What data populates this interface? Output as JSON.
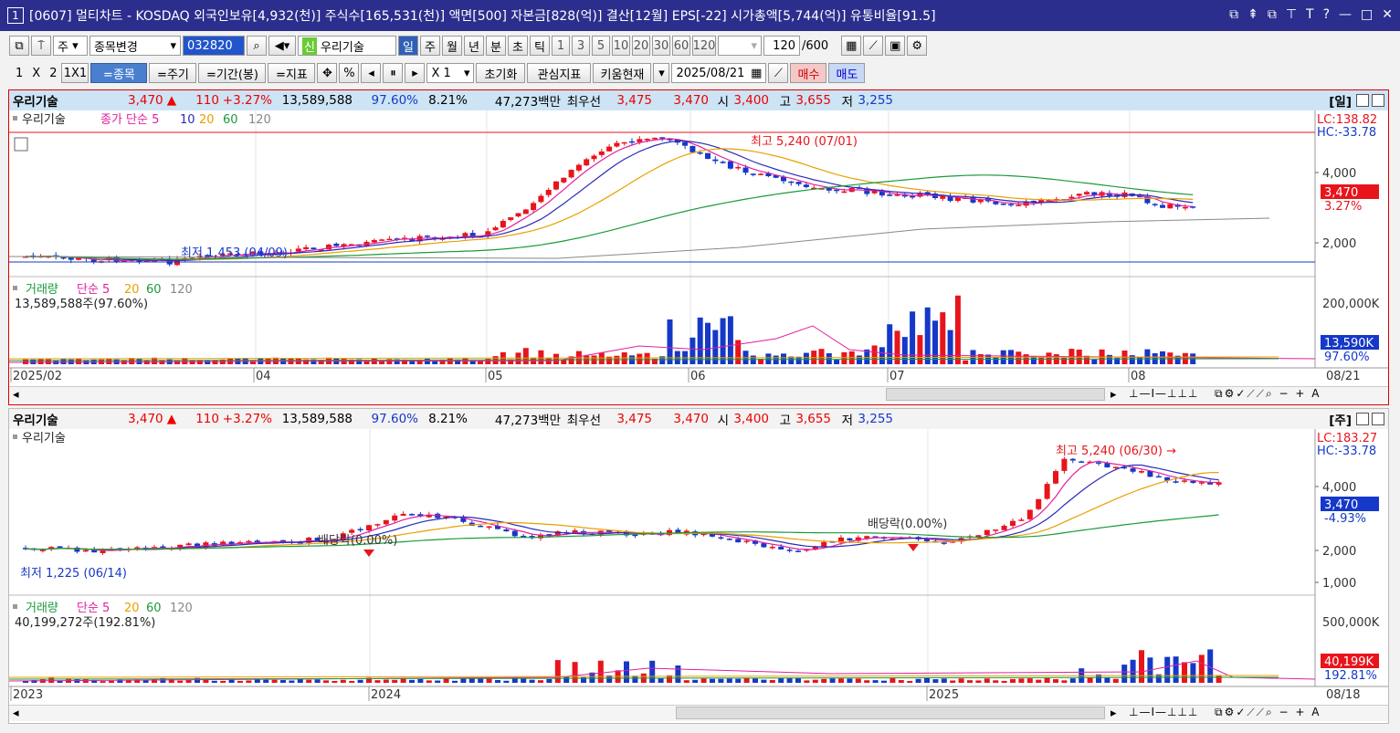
{
  "window": {
    "num": "1",
    "title": "[0607] 멀티차트 - KOSDAQ 외국인보유[4,932(천)] 주식수[165,531(천)] 액면[500] 자본금[828(억)] 결산[12월] EPS[-22] 시가총액[5,744(억)] 유통비율[91.5]",
    "controls": [
      "⧉",
      "⇞",
      "⧉",
      "⊤",
      "T",
      "?",
      "—",
      "□",
      "✕"
    ]
  },
  "toolbar1": {
    "mode": "주",
    "stock_change": "종목변경",
    "code": "032820",
    "name_badge": "신",
    "stock_name": "우리기술",
    "periods": [
      "일",
      "주",
      "월",
      "년",
      "분",
      "초",
      "틱"
    ],
    "selected_period": "일",
    "nums": [
      "1",
      "3",
      "5",
      "10",
      "20",
      "30",
      "60",
      "120"
    ],
    "count": "120",
    "total": "/600"
  },
  "toolbar2": {
    "layout": [
      "1",
      "X",
      "2"
    ],
    "layout2": "1X1",
    "btn_stock": "=종목",
    "btn_cycle": "=주기",
    "btn_range": "=기간(봉)",
    "btn_indicator": "=지표",
    "pct": "%",
    "zoom": "X 1",
    "reset": "초기화",
    "interest": "관심지표",
    "kiwoom": "키움현재",
    "date": "2025/08/21",
    "buy": "매수",
    "sell": "매도"
  },
  "colors": {
    "up": "#e8141c",
    "down": "#1538c8",
    "ma5": "#e020a0",
    "ma10": "#2a2ab8",
    "ma20": "#e8a000",
    "ma60": "#1a9a3a",
    "ma120": "#888888"
  },
  "info": {
    "name": "우리기술",
    "price": "3,470",
    "arrow": "▲",
    "change": "110",
    "pct": "+3.27%",
    "volume": "13,589,588",
    "vol_pct": "97.60%",
    "turnover": "8.21%",
    "amount": "47,273백만",
    "best": "최우선",
    "ask": "3,475",
    "bid": "3,470",
    "open_lbl": "시",
    "open": "3,400",
    "high_lbl": "고",
    "high": "3,655",
    "low_lbl": "저",
    "low": "3,255"
  },
  "panel_top": {
    "period": "[일]",
    "legend_name": "우리기술",
    "ma_label": "종가 단순",
    "ma": [
      "5",
      "10",
      "20",
      "60",
      "120"
    ],
    "max_label": "최고 5,240 (07/01)",
    "min_label": "최저 1,453 (04/09)",
    "lc": "LC:138.82",
    "hc": "HC:-33.78",
    "y_ticks": [
      "4,000",
      "2,000"
    ],
    "price_tag": "3,470",
    "pct_tag": "3.27%",
    "vol_legend": "거래량",
    "vol_ma_label": "단순",
    "vol_info": "13,589,588주(97.60%)",
    "vol_tick": "200,000K",
    "vol_tag": "13,590K",
    "vol_pct_tag": "97.60%",
    "x_labels": [
      "2025/02",
      "04",
      "05",
      "06",
      "07",
      "08"
    ],
    "x_right": "08/21"
  },
  "panel_bottom": {
    "period": "[주]",
    "legend_name": "우리기술",
    "max_label": "최고 5,240 (06/30)",
    "min_label": "최저 1,225 (06/14)",
    "div1": "배당락(0.00%)",
    "div2": "배당락(0.00%)",
    "lc": "LC:183.27",
    "hc": "HC:-33.78",
    "y_ticks": [
      "4,000",
      "2,000",
      "1,000"
    ],
    "price_tag": "3,470",
    "pct_tag": "-4.93%",
    "vol_legend": "거래량",
    "vol_ma_label": "단순",
    "vol_info": "40,199,272주(192.81%)",
    "vol_tick": "500,000K",
    "vol_tag": "40,199K",
    "vol_pct_tag": "192.81%",
    "x_labels": [
      "2023",
      "2024",
      "2025"
    ],
    "x_right": "08/18"
  }
}
